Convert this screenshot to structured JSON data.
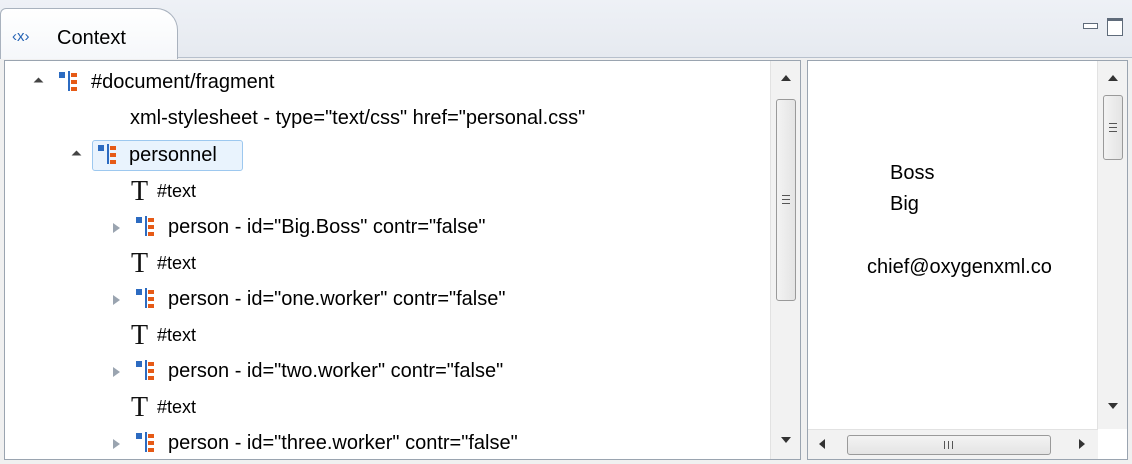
{
  "tab": {
    "icon_text": "‹x›",
    "label": "Context"
  },
  "tree": {
    "root": {
      "label": "#document/fragment"
    },
    "pi": {
      "label": "xml-stylesheet - type=\"text/css\" href=\"personal.css\""
    },
    "personnel": {
      "label": "personnel"
    },
    "children": [
      {
        "kind": "text",
        "label": "#text"
      },
      {
        "kind": "element",
        "label": "person - id=\"Big.Boss\" contr=\"false\""
      },
      {
        "kind": "text",
        "label": "#text"
      },
      {
        "kind": "element",
        "label": "person - id=\"one.worker\" contr=\"false\""
      },
      {
        "kind": "text",
        "label": "#text"
      },
      {
        "kind": "element",
        "label": "person - id=\"two.worker\" contr=\"false\""
      },
      {
        "kind": "text",
        "label": "#text"
      },
      {
        "kind": "element",
        "label": "person - id=\"three.worker\" contr=\"false\""
      }
    ]
  },
  "preview": {
    "family": "Boss",
    "given": "Big",
    "email": "chief@oxygenxml.co"
  }
}
